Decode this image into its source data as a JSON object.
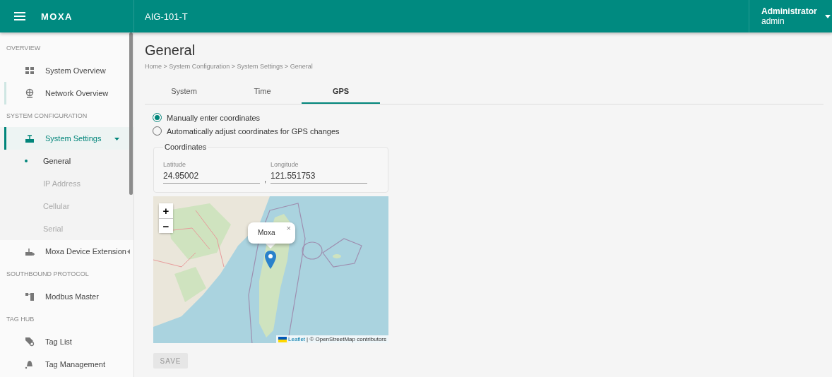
{
  "header": {
    "logo": "MOXA",
    "device": "AIG-101-T",
    "user": {
      "role": "Administrator",
      "name": "admin"
    }
  },
  "sidebar": {
    "sections": [
      {
        "title": "OVERVIEW",
        "items": [
          {
            "label": "System Overview",
            "selected": false,
            "hovered": false
          },
          {
            "label": "Network Overview",
            "selected": false,
            "hovered": true
          }
        ]
      },
      {
        "title": "SYSTEM CONFIGURATION",
        "items": [
          {
            "label": "System Settings",
            "selected": true,
            "hovered": false,
            "expanded": true,
            "children": [
              {
                "label": "General",
                "selected": true
              },
              {
                "label": "IP Address",
                "selected": false
              },
              {
                "label": "Cellular",
                "selected": false
              },
              {
                "label": "Serial",
                "selected": false
              }
            ]
          },
          {
            "label": "Moxa Device Extension",
            "selected": false,
            "hovered": false,
            "expanded": false
          }
        ]
      },
      {
        "title": "SOUTHBOUND PROTOCOL",
        "items": [
          {
            "label": "Modbus Master",
            "selected": false,
            "hovered": false
          }
        ]
      },
      {
        "title": "TAG HUB",
        "items": [
          {
            "label": "Tag List",
            "selected": false,
            "hovered": false
          },
          {
            "label": "Tag Management",
            "selected": false,
            "hovered": false
          }
        ]
      }
    ]
  },
  "page": {
    "title": "General",
    "breadcrumb": "Home > System Configuration > System Settings > General"
  },
  "tabs": [
    {
      "label": "System",
      "selected": false
    },
    {
      "label": "Time",
      "selected": false
    },
    {
      "label": "GPS",
      "selected": true
    }
  ],
  "mode_options": [
    {
      "label": "Manually enter coordinates",
      "selected": true
    },
    {
      "label": "Automatically adjust coordinates for GPS changes",
      "selected": false
    }
  ],
  "coordinates": {
    "legend": "Coordinates",
    "latitude": {
      "label": "Latitude",
      "value": "24.95002"
    },
    "separator": ",",
    "longitude": {
      "label": "Longitude",
      "value": "121.551753"
    }
  },
  "map": {
    "kind": "picture",
    "zoom_in": "+",
    "zoom_out": "−",
    "popup": {
      "text": "Moxa",
      "close": "×"
    },
    "attribution": {
      "link": "Leaflet",
      "text": "| © OpenStreetMap contributors"
    }
  },
  "save_button": {
    "label": "SAVE",
    "disabled": true
  }
}
